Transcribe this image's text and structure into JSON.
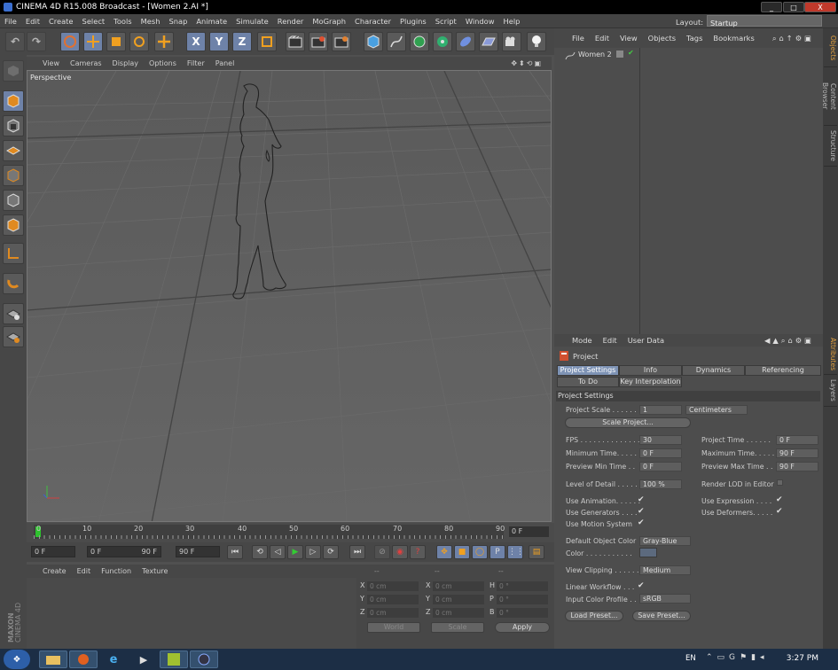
{
  "window": {
    "title": "CINEMA 4D R15.008 Broadcast - [Women 2.AI *]",
    "min": "_",
    "max": "□",
    "close": "X"
  },
  "menu": [
    "File",
    "Edit",
    "Create",
    "Select",
    "Tools",
    "Mesh",
    "Snap",
    "Animate",
    "Simulate",
    "Render",
    "MoGraph",
    "Character",
    "Plugins",
    "Script",
    "Window",
    "Help"
  ],
  "layout": {
    "label": "Layout:",
    "value": "Startup"
  },
  "toolbar": {
    "x": "X",
    "y": "Y",
    "z": "Z"
  },
  "viewport": {
    "menu": [
      "View",
      "Cameras",
      "Display",
      "Options",
      "Filter",
      "Panel"
    ],
    "label": "Perspective"
  },
  "timeline": {
    "ticks": [
      "0",
      "10",
      "20",
      "30",
      "40",
      "50",
      "60",
      "70",
      "80",
      "90"
    ],
    "current": "0 F"
  },
  "transport": {
    "start": "0 F",
    "min": "0 F",
    "max": "90 F",
    "end": "90 F"
  },
  "material": {
    "menu": [
      "Create",
      "Edit",
      "Function",
      "Texture"
    ]
  },
  "coords": {
    "headers": [
      "--",
      "--",
      "--"
    ],
    "rows": [
      {
        "a": "X",
        "av": "0 cm",
        "b": "X",
        "bv": "0 cm",
        "c": "H",
        "cv": "0 °"
      },
      {
        "a": "Y",
        "av": "0 cm",
        "b": "Y",
        "bv": "0 cm",
        "c": "P",
        "cv": "0 °"
      },
      {
        "a": "Z",
        "av": "0 cm",
        "b": "Z",
        "bv": "0 cm",
        "c": "B",
        "cv": "0 °"
      }
    ],
    "world": "World",
    "scale": "Scale",
    "apply": "Apply"
  },
  "objects": {
    "menu": [
      "File",
      "Edit",
      "View",
      "Objects",
      "Tags",
      "Bookmarks"
    ],
    "item": "Women 2"
  },
  "side_tabs": [
    "Objects",
    "Content Browser",
    "Structure",
    "Attributes",
    "Layers"
  ],
  "attributes": {
    "menu": [
      "Mode",
      "Edit",
      "User Data"
    ],
    "title": "Project",
    "tabs": [
      "Project Settings",
      "Info",
      "Dynamics",
      "Referencing",
      "To Do",
      "Key Interpolation"
    ],
    "section": "Project Settings",
    "project_scale_label": "Project Scale . . . . . .",
    "project_scale": "1",
    "units": "Centimeters",
    "scale_project": "Scale Project...",
    "fps_label": "FPS . . . . . . . . . . . . . .",
    "fps": "30",
    "project_time_label": "Project Time . . . . . .",
    "project_time": "0 F",
    "min_time_label": "Minimum Time. . . . . .",
    "min_time": "0 F",
    "max_time_label": "Maximum Time. . . . . .",
    "max_time": "90 F",
    "prev_min_label": "Preview Min Time . .",
    "prev_min": "0 F",
    "prev_max_label": "Preview Max Time . .",
    "prev_max": "90 F",
    "lod_label": "Level of Detail . . . . .",
    "lod": "100 %",
    "render_lod_label": "Render LOD in Editor",
    "use_anim": "Use Animation. . . . . .",
    "use_expr": "Use Expression . . . .",
    "use_gen": "Use Generators . . . .",
    "use_def": "Use Deformers. . . . .",
    "use_motion": "Use Motion System",
    "doc_label": "Default Object Color",
    "doc": "Gray-Blue",
    "color_label": "Color . . . . . . . . . . .",
    "view_clip_label": "View Clipping . . . . . .",
    "view_clip": "Medium",
    "linear_label": "Linear Workflow . . .",
    "icp_label": "Input Color Profile . .",
    "icp": "sRGB",
    "load_preset": "Load Preset...",
    "save_preset": "Save Preset...",
    "check": "✔"
  },
  "taskbar": {
    "lang": "EN",
    "time": "3:27 PM"
  }
}
